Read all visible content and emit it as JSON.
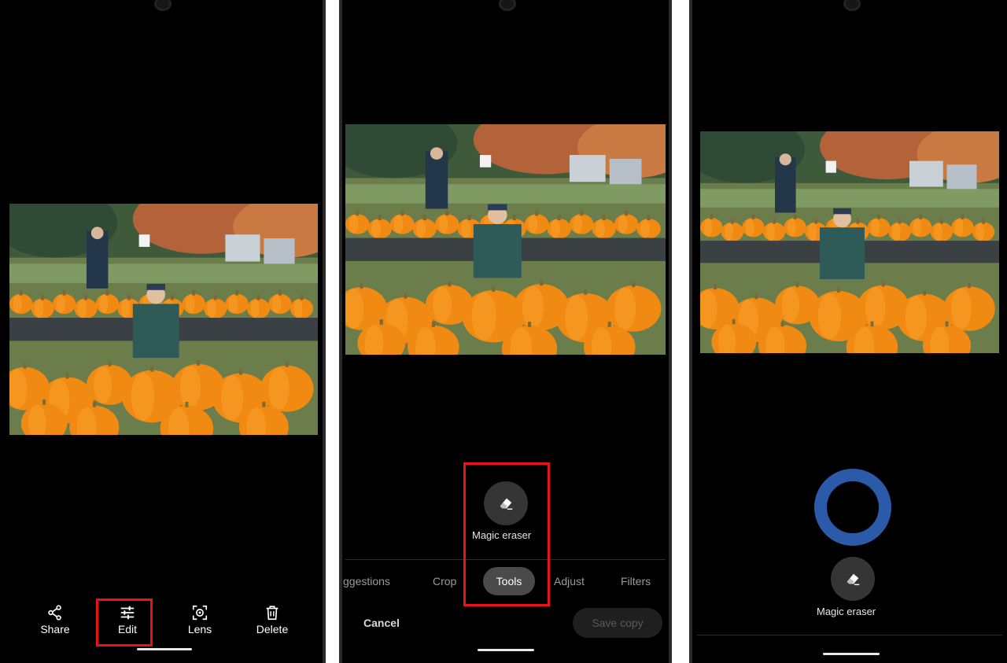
{
  "screens": [
    {
      "id": "photo-viewer",
      "actions": [
        {
          "label": "Share",
          "icon": "share-icon"
        },
        {
          "label": "Edit",
          "icon": "sliders-icon"
        },
        {
          "label": "Lens",
          "icon": "lens-icon"
        },
        {
          "label": "Delete",
          "icon": "trash-icon"
        }
      ],
      "highlighted": "Edit"
    },
    {
      "id": "photo-editor-tools",
      "tool": {
        "label": "Magic eraser",
        "icon": "eraser-icon"
      },
      "tabs": [
        "ggestions",
        "Crop",
        "Tools",
        "Adjust",
        "Filters"
      ],
      "active_tab": "Tools",
      "cancel_label": "Cancel",
      "save_label": "Save copy"
    },
    {
      "id": "magic-eraser-active",
      "tool": {
        "label": "Magic eraser",
        "icon": "eraser-icon"
      },
      "ring_color": "#2b5aa8"
    }
  ],
  "colors": {
    "highlight": "#e8131a",
    "pumpkin": "#f08a12",
    "background": "#000000"
  }
}
